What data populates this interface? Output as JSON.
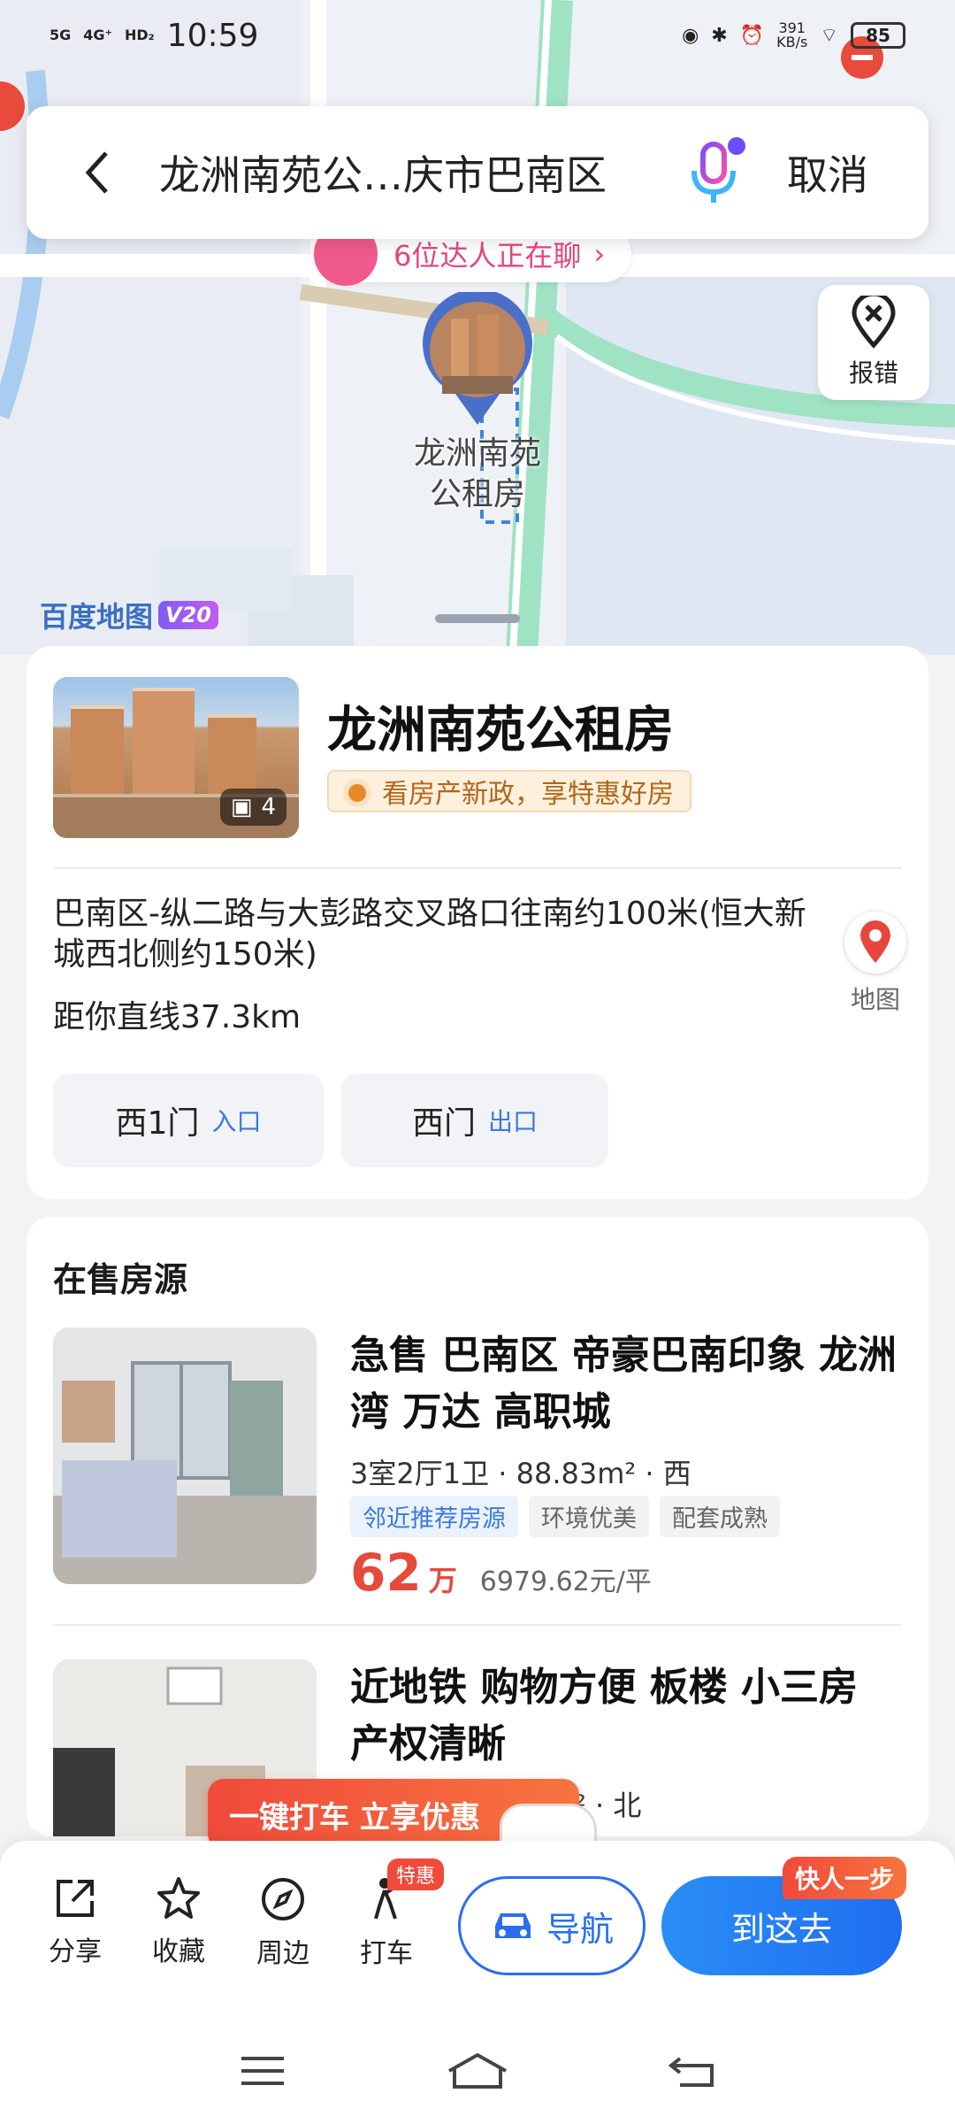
{
  "status_bar": {
    "network1": "5G",
    "network2": "4G⁺",
    "hd": "HD₂",
    "time": "10:59",
    "speed": "391",
    "speed_unit": "KB/s",
    "battery": "85"
  },
  "search": {
    "query": "龙洲南苑公…庆市巴南区",
    "cancel_label": "取消"
  },
  "map": {
    "chat_pill": "6位达人正在聊",
    "report_label": "报错",
    "poi_label_line1": "龙洲南苑",
    "poi_label_line2": "公租房",
    "brand": "百度地图",
    "brand_version": "V20"
  },
  "poi": {
    "title": "龙洲南苑公租房",
    "photo_count": "4",
    "promo": "看房产新政，享特惠好房",
    "address": "巴南区-纵二路与大彭路交叉路口往南约100米(恒大新城西北侧约150米)",
    "distance": "距你直线37.3km",
    "map_label": "地图",
    "gates": [
      {
        "name": "西1门",
        "type": "入口"
      },
      {
        "name": "西门",
        "type": "出口"
      }
    ]
  },
  "listings": {
    "section_title": "在售房源",
    "items": [
      {
        "title": "急售 巴南区 帝豪巴南印象 龙洲湾 万达 高职城",
        "specs": "3室2厅1卫 · 88.83m² · 西",
        "tags": [
          "邻近推荐房源",
          "环境优美",
          "配套成熟"
        ],
        "price": "62",
        "price_unit": "万",
        "unit_price": "6979.62元/平"
      },
      {
        "title": "近地铁 购物方便 板楼 小三房 产权清晰",
        "specs": "² · 北"
      }
    ]
  },
  "taxi_promo": "一键打车 立享优惠",
  "bottom_bar": {
    "share": "分享",
    "favorite": "收藏",
    "nearby": "周边",
    "taxi": "打车",
    "taxi_badge": "特惠",
    "navigate": "导航",
    "go_here": "到这去",
    "fast_badge": "快人一步"
  },
  "colors": {
    "accent": "#2a6ef0",
    "price": "#e64a3b",
    "promo": "#f04a3b"
  }
}
